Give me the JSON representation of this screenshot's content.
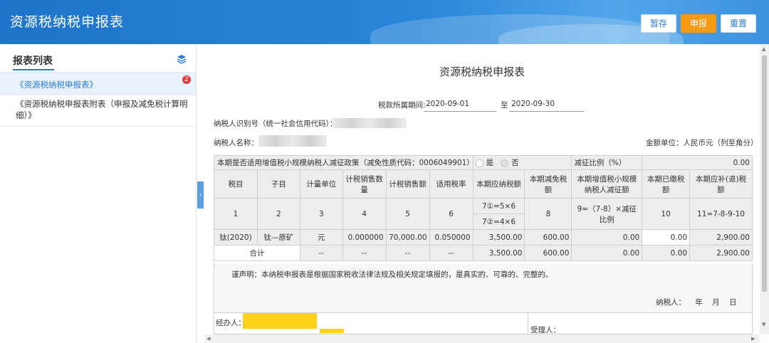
{
  "header": {
    "title": "资源税纳税申报表",
    "buttons": {
      "save": "暂存",
      "submit": "申报",
      "reset": "重置"
    }
  },
  "sidebar": {
    "title": "报表列表",
    "icon": "layers-icon",
    "items": [
      {
        "label": "《资源税纳税申报表》",
        "badge": "2",
        "active": true
      },
      {
        "label": "《资源税纳税申报表附表（申报及减免税计算明细）》",
        "active": false
      }
    ]
  },
  "form": {
    "title": "资源税纳税申报表",
    "period_label": "税款所属期间:",
    "period_start": "2020-09-01",
    "period_to": "至",
    "period_end": "2020-09-30",
    "taxpayer_id_label": "纳税人识别号（统一社会信用代码）：",
    "taxpayer_name_label": "纳税人名称：",
    "currency_unit": "金额单位：人民币元（列至角分）",
    "policy_question": "本期是否适用增值税小规模纳税人减征政策（减免性质代码：0006049901）",
    "option_yes": "是",
    "option_no": "否",
    "reduction_ratio_label": "减征比例（%）",
    "reduction_ratio_value": "0.00",
    "columns": [
      "税目",
      "子目",
      "计量单位",
      "计税销售数量",
      "计税销售额",
      "适用税率",
      "本期应纳税额",
      "本期减免税额",
      "本期增值税小规模纳税人减征额",
      "本期已缴税额",
      "本期应补(退)税额"
    ],
    "col_index": [
      "1",
      "2",
      "3",
      "4",
      "5",
      "6",
      "7①=5×6",
      "7②=4×6",
      "8",
      "9=（7-8）×减征比例",
      "10",
      "11=7-8-9-10"
    ],
    "rows": [
      {
        "item": "钛(2020)",
        "subitem": "钛—原矿",
        "unit": "元",
        "quantity": "0.000000",
        "sales": "70,000.00",
        "rate": "0.050000",
        "payable": "3,500.00",
        "relief": "600.00",
        "small_reduction": "0.00",
        "paid": "0.00",
        "due": "2,900.00"
      }
    ],
    "total": {
      "label": "合计",
      "unit": "--",
      "quantity": "--",
      "sales": "--",
      "rate": "--",
      "payable": "3,500.00",
      "relief": "600.00",
      "small_reduction": "0.00",
      "paid": "0.00",
      "due": "2,900.00"
    },
    "declaration": "谨声明：本纳税申报表是根据国家税收法律法规及相关规定填报的，是真实的、可靠的、完整的。",
    "signature": "纳税人：  年  月  日",
    "handler_label": "经办人：",
    "agent_label": "受理人："
  }
}
